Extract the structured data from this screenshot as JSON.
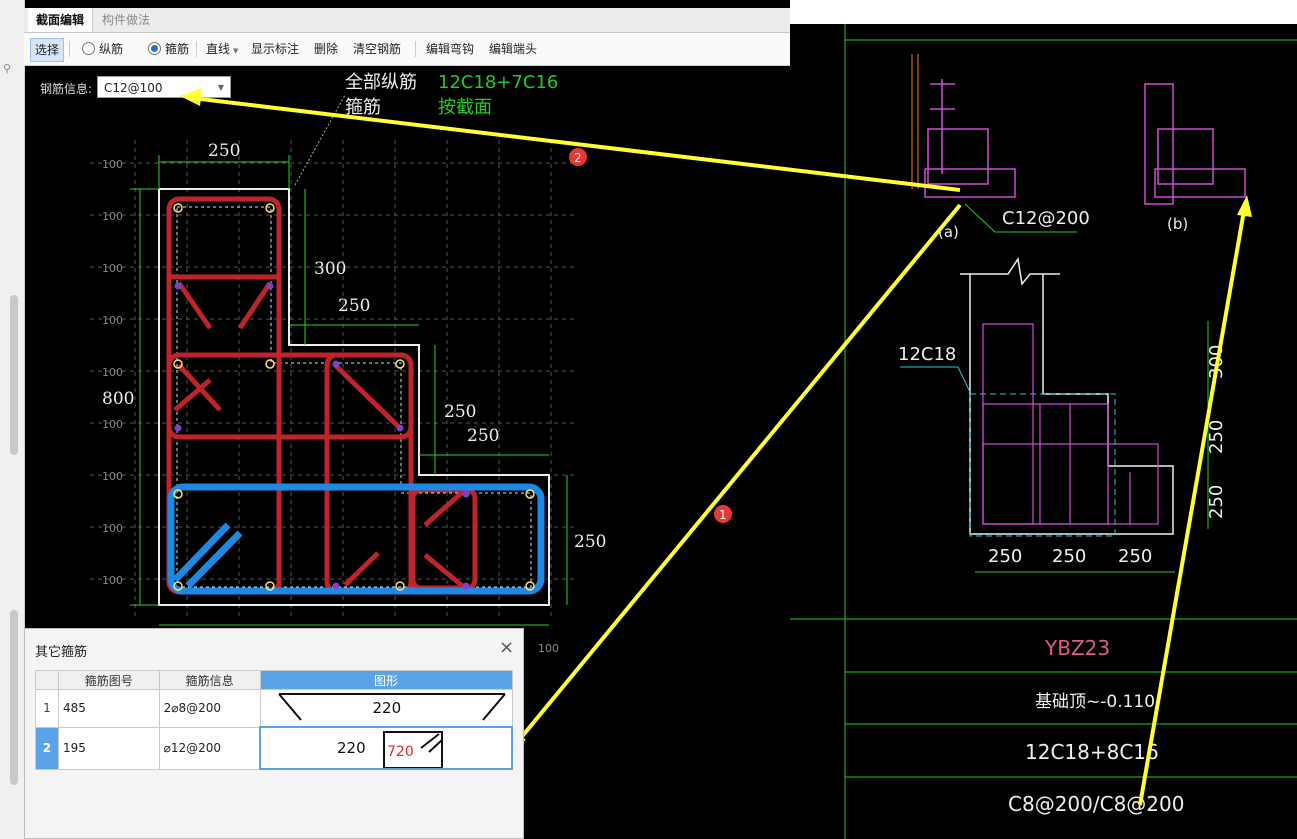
{
  "tabs": [
    {
      "label": "截面编辑",
      "active": true
    },
    {
      "label": "构件做法",
      "active": false
    }
  ],
  "toolbar": {
    "select": "选择",
    "longitudinal": "纵筋",
    "stirrup": "箍筋",
    "line": "直线",
    "show_label": "显示标注",
    "delete": "删除",
    "clear": "清空钢筋",
    "edit_hook": "编辑弯钩",
    "edit_end": "编辑端头"
  },
  "rebar_info": {
    "label": "钢筋信息:",
    "value": "C12@100"
  },
  "canvas_text": {
    "all_long_label": "全部纵筋",
    "all_long_value": "12C18+7C16",
    "stirrup_label": "箍筋",
    "stirrup_value": "按截面"
  },
  "dims": {
    "d250_top": "250",
    "d300": "300",
    "d250_a": "250",
    "d800": "800",
    "d250_b": "250",
    "d250_c": "250",
    "d250_right": "250",
    "grid": "100"
  },
  "markers": {
    "one": "1",
    "two": "2"
  },
  "dialog": {
    "title": "其它箍筋",
    "close": "×",
    "headers": [
      "箍筋图号",
      "箍筋信息",
      "图形"
    ],
    "rows": [
      {
        "num": "1",
        "code": "485",
        "info": "2⌀8@200",
        "shape_val": "220"
      },
      {
        "num": "2",
        "code": "195",
        "info": "⌀12@200",
        "shape_val": "220",
        "shape_red": "720"
      }
    ]
  },
  "cad": {
    "ref_a_label": "C12@200",
    "a": "(a)",
    "b": "(b)",
    "rebar_label": "12C18",
    "dim300": "300",
    "dim250v1": "250",
    "dim250v2": "250",
    "dim250h1": "250",
    "dim250h2": "250",
    "dim250h3": "250",
    "name": "YBZ23",
    "elevation": "基础顶~-0.110",
    "longitudinal": "12C18+8C16",
    "stirrup": "C8@200/C8@200"
  },
  "colors": {
    "red_rebar": "#c0242b",
    "blue_rebar": "#1e88e5",
    "cad_magenta": "#d04bd6",
    "cad_green": "#16d216",
    "callout": "#ffff33"
  }
}
